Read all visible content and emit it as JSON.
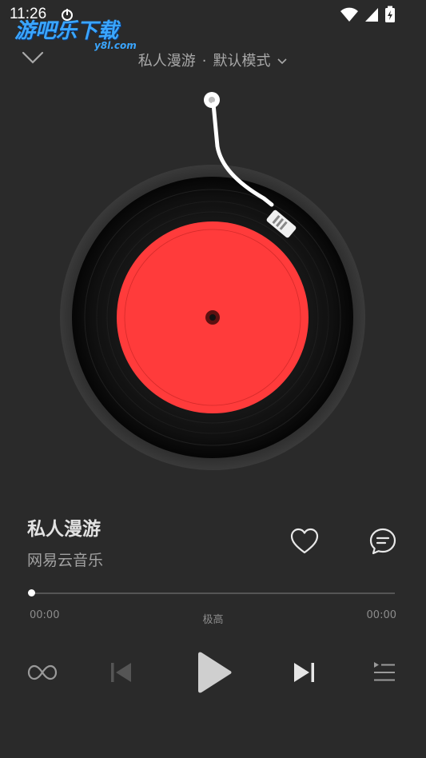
{
  "status_bar": {
    "time": "11:26",
    "icons": [
      "wifi-icon",
      "cellular-signal-icon",
      "battery-charging-icon"
    ]
  },
  "watermark": {
    "title": "游吧乐下载",
    "subtitle": "y8l.com"
  },
  "header": {
    "mode_source": "私人漫游",
    "separator": "·",
    "mode_label": "默认模式"
  },
  "record": {
    "label_color": "#ff3b3b",
    "disc_color": "#111111"
  },
  "song": {
    "title": "私人漫游",
    "artist": "网易云音乐",
    "liked": false
  },
  "progress": {
    "current_time": "00:00",
    "total_time": "00:00",
    "quality": "极高",
    "fraction": 0
  },
  "controls": {
    "mode_icon": "loop-icon",
    "prev_icon": "previous-icon",
    "play_icon": "play-icon",
    "next_icon": "next-icon",
    "playlist_icon": "playlist-icon"
  },
  "colors": {
    "background": "#2a2a2a",
    "accent_red": "#ff3b3b"
  }
}
